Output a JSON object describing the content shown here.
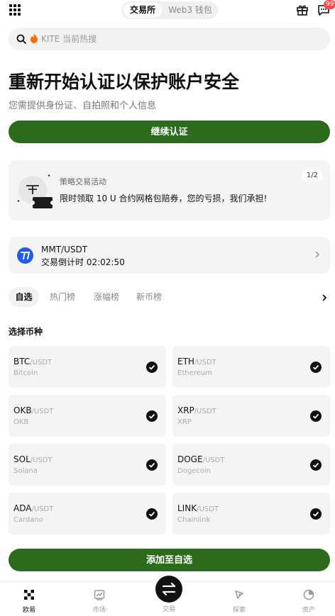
{
  "header": {
    "tabs": [
      {
        "label": "交易所",
        "active": true
      },
      {
        "label": "Web3 钱包",
        "active": false
      }
    ],
    "message_badge": "99"
  },
  "search": {
    "hot_icon": "fire-icon",
    "placeholder": "KITE 当前热搜"
  },
  "verify": {
    "title": "重新开始认证以保护账户安全",
    "subtitle": "您需提供身份证、自拍照和个人信息",
    "button": "继续认证"
  },
  "promo": {
    "title": "策略交易活动",
    "description": "限时领取 10 U 合约网格包赔券，您的亏损，我们承担!",
    "pager": "1/2"
  },
  "countdown": {
    "pair": "MMT/USDT",
    "timer_text": "交易倒计时 02:02:50"
  },
  "market_tabs": [
    {
      "label": "自选",
      "active": true
    },
    {
      "label": "热门榜",
      "active": false
    },
    {
      "label": "涨幅榜",
      "active": false
    },
    {
      "label": "新币榜",
      "active": false
    }
  ],
  "select_section": {
    "title": "选择币种",
    "coins": [
      {
        "symbol": "BTC",
        "quote": "/USDT",
        "name": "Bitcoin",
        "selected": true
      },
      {
        "symbol": "ETH",
        "quote": "/USDT",
        "name": "Ethereum",
        "selected": true
      },
      {
        "symbol": "OKB",
        "quote": "/USDT",
        "name": "OKB",
        "selected": true
      },
      {
        "symbol": "XRP",
        "quote": "/USDT",
        "name": "XRP",
        "selected": true
      },
      {
        "symbol": "SOL",
        "quote": "/USDT",
        "name": "Solana",
        "selected": true
      },
      {
        "symbol": "DOGE",
        "quote": "/USDT",
        "name": "Dogecoin",
        "selected": true
      },
      {
        "symbol": "ADA",
        "quote": "/USDT",
        "name": "Cardano",
        "selected": true
      },
      {
        "symbol": "LINK",
        "quote": "/USDT",
        "name": "Chainlink",
        "selected": true
      }
    ],
    "add_button": "添加至自选"
  },
  "bottom_nav": [
    {
      "label": "欧易",
      "icon": "okx-logo-icon",
      "active": true
    },
    {
      "label": "市场",
      "icon": "chart-icon",
      "active": false
    },
    {
      "label": "交易",
      "icon": "swap-icon",
      "active": false
    },
    {
      "label": "探索",
      "icon": "compass-icon",
      "active": false
    },
    {
      "label": "资产",
      "icon": "pie-chart-icon",
      "active": false
    }
  ],
  "colors": {
    "primary_green": "#2c6b1b",
    "badge_red": "#ff4d4f",
    "coin_blue": "#1f5af2",
    "card_bg": "#f4f4f4"
  }
}
